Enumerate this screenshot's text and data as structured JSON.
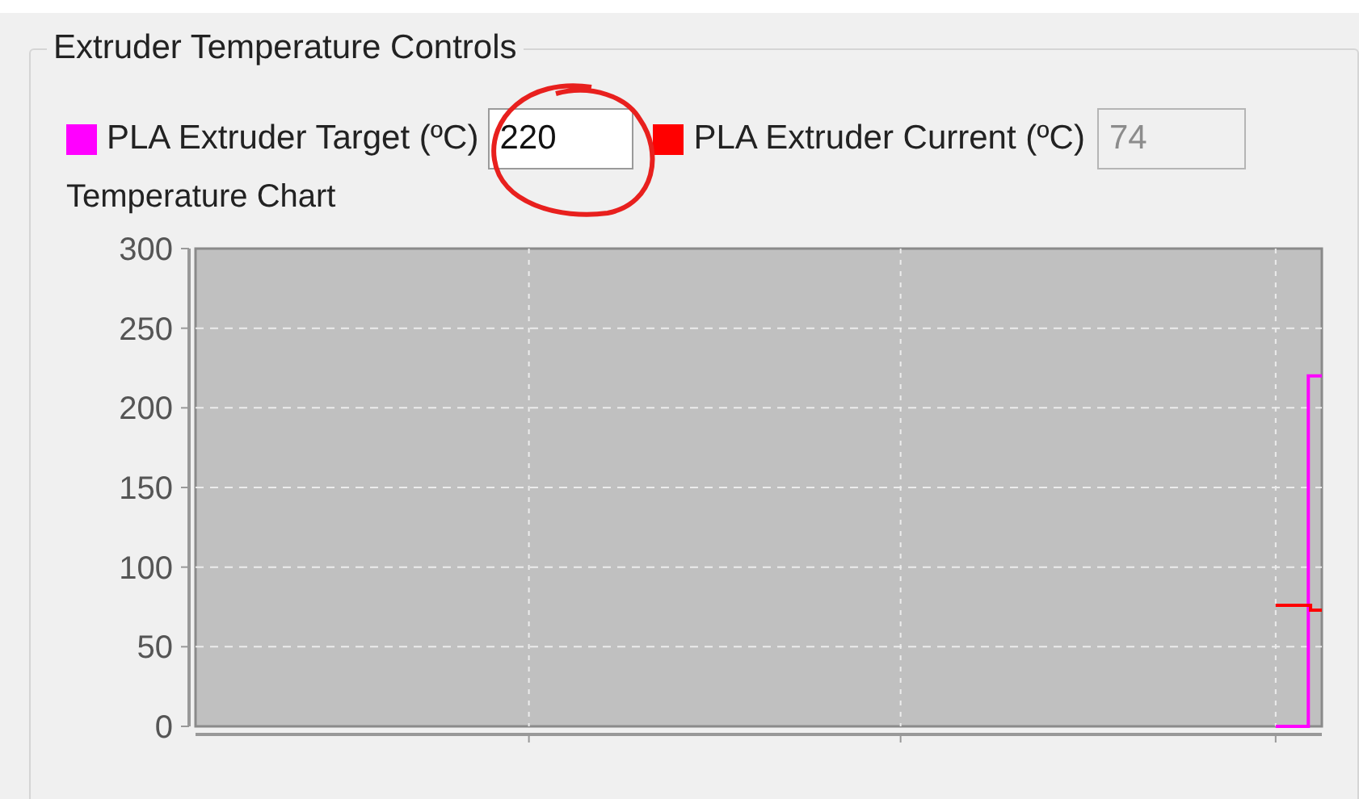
{
  "group": {
    "title": "Extruder Temperature Controls"
  },
  "target": {
    "color": "#ff00ff",
    "label": "PLA Extruder Target (ºC)",
    "value": "220"
  },
  "current": {
    "color": "#ff0000",
    "label": "PLA Extruder Current (ºC)",
    "value": "74",
    "disabled": true
  },
  "chart": {
    "title": "Temperature Chart",
    "y_labels": [
      "300",
      "250",
      "200",
      "150",
      "100",
      "50",
      "0"
    ]
  }
}
